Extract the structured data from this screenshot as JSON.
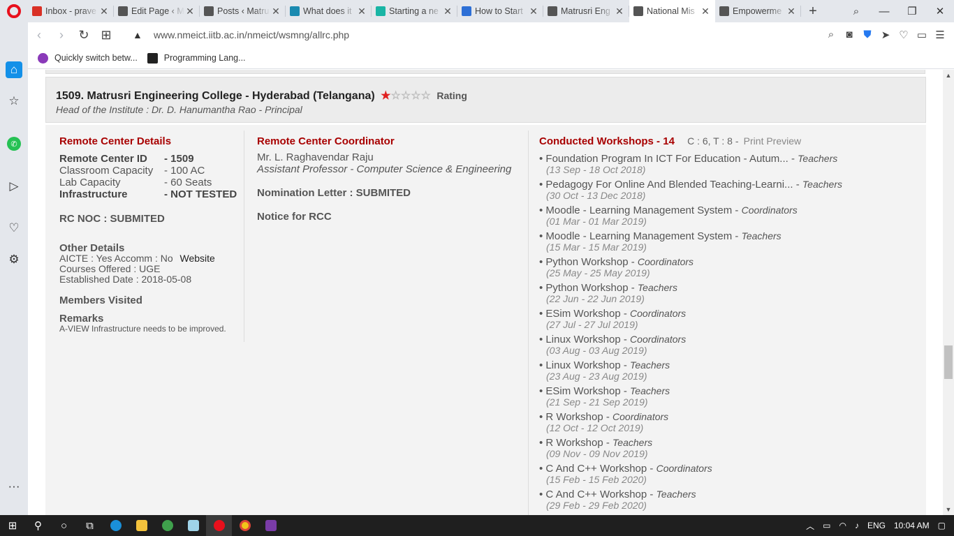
{
  "tabs": [
    {
      "title": "Inbox - prave",
      "icon": "gmail-icon",
      "color": "#d93025",
      "active": false
    },
    {
      "title": "Edit Page ‹ M",
      "icon": "page-icon",
      "color": "#555555",
      "active": false
    },
    {
      "title": "Posts ‹ Matru",
      "icon": "page-icon",
      "color": "#555555",
      "active": false
    },
    {
      "title": "What does it",
      "icon": "site-icon",
      "color": "#1a8ab0",
      "active": false
    },
    {
      "title": "Starting a ne",
      "icon": "rg-icon",
      "color": "#19b5a5",
      "active": false
    },
    {
      "title": "How to Start",
      "icon": "link-icon",
      "color": "#2d6fd6",
      "active": false
    },
    {
      "title": "Matrusri Eng",
      "icon": "page-icon",
      "color": "#555555",
      "active": false
    },
    {
      "title": "National Mis",
      "icon": "page-icon",
      "color": "#555555",
      "active": true
    },
    {
      "title": "Empowerme",
      "icon": "page-icon",
      "color": "#555555",
      "active": false
    }
  ],
  "address": {
    "url": "www.nmeict.iitb.ac.in/nmeict/wsmng/allrc.php"
  },
  "bookmarks": [
    {
      "label": "Quickly switch betw...",
      "color": "#8a3ab9"
    },
    {
      "label": "Programming Lang...",
      "color": "#222222"
    }
  ],
  "college": {
    "title": "1509. Matrusri Engineering College - Hyderabad (Telangana)",
    "rating_filled": 1,
    "rating_total": 5,
    "rating_label": "Rating",
    "head": "Head of the Institute : Dr. D. Hanumantha Rao - Principal"
  },
  "rc_details": {
    "heading": "Remote Center Details",
    "rows": [
      {
        "label": "Remote Center ID",
        "value": "- 1509",
        "bold": true
      },
      {
        "label": "Classroom Capacity",
        "value": "- 100 AC",
        "bold": false
      },
      {
        "label": "Lab Capacity",
        "value": "- 60 Seats",
        "bold": false
      },
      {
        "label": "Infrastructure",
        "value": "- NOT TESTED",
        "bold": true
      }
    ],
    "noc_label": "RC NOC  : SUBMITED",
    "other_heading": "Other Details",
    "aicte": "AICTE : Yes   Accomm : No",
    "website": "Website",
    "courses": "Courses Offered : UGE",
    "established": "Established Date : 2018-05-08",
    "members_visited": "Members Visited",
    "remarks_heading": "Remarks",
    "remarks_text": "A-VIEW Infrastructure needs to be improved."
  },
  "coordinator": {
    "heading": "Remote Center Coordinator",
    "name": "Mr. L. Raghavendar Raju",
    "designation": "Assistant Professor - Computer Science & Engineering",
    "nomination": "Nomination Letter : SUBMITED",
    "notice": "Notice for RCC"
  },
  "workshops": {
    "heading": "Conducted Workshops - 14",
    "counts": "C : 6, T : 8 -",
    "print_preview": "Print Preview",
    "items": [
      {
        "title": "Foundation Program In ICT For Education - Autum...",
        "role": "Teachers",
        "date": "(13 Sep - 18 Oct 2018)"
      },
      {
        "title": "Pedagogy For Online And Blended Teaching-Learni...",
        "role": "Teachers",
        "date": "(30 Oct - 13 Dec 2018)"
      },
      {
        "title": "Moodle - Learning Management System",
        "role": "Coordinators",
        "date": "(01 Mar - 01 Mar 2019)"
      },
      {
        "title": "Moodle - Learning Management System",
        "role": "Teachers",
        "date": "(15 Mar - 15 Mar 2019)"
      },
      {
        "title": "Python Workshop",
        "role": "Coordinators",
        "date": "(25 May - 25 May 2019)"
      },
      {
        "title": "Python Workshop",
        "role": "Teachers",
        "date": "(22 Jun - 22 Jun 2019)"
      },
      {
        "title": "ESim Workshop",
        "role": "Coordinators",
        "date": "(27 Jul - 27 Jul 2019)"
      },
      {
        "title": "Linux Workshop",
        "role": "Coordinators",
        "date": "(03 Aug - 03 Aug 2019)"
      },
      {
        "title": "Linux Workshop",
        "role": "Teachers",
        "date": "(23 Aug - 23 Aug 2019)"
      },
      {
        "title": "ESim Workshop",
        "role": "Teachers",
        "date": "(21 Sep - 21 Sep 2019)"
      },
      {
        "title": "R Workshop",
        "role": "Coordinators",
        "date": "(12 Oct - 12 Oct 2019)"
      },
      {
        "title": "R Workshop",
        "role": "Teachers",
        "date": "(09 Nov - 09 Nov 2019)"
      },
      {
        "title": "C And C++ Workshop",
        "role": "Coordinators",
        "date": "(15 Feb - 15 Feb 2020)"
      },
      {
        "title": "C And C++ Workshop",
        "role": "Teachers",
        "date": "(29 Feb - 29 Feb 2020)"
      }
    ]
  },
  "taskbar": {
    "lang": "ENG",
    "time": "10:04 AM"
  },
  "colors": {
    "accent_red": "#a80000",
    "opera_red": "#e8101c",
    "sidebar_blue": "#1390e8"
  }
}
